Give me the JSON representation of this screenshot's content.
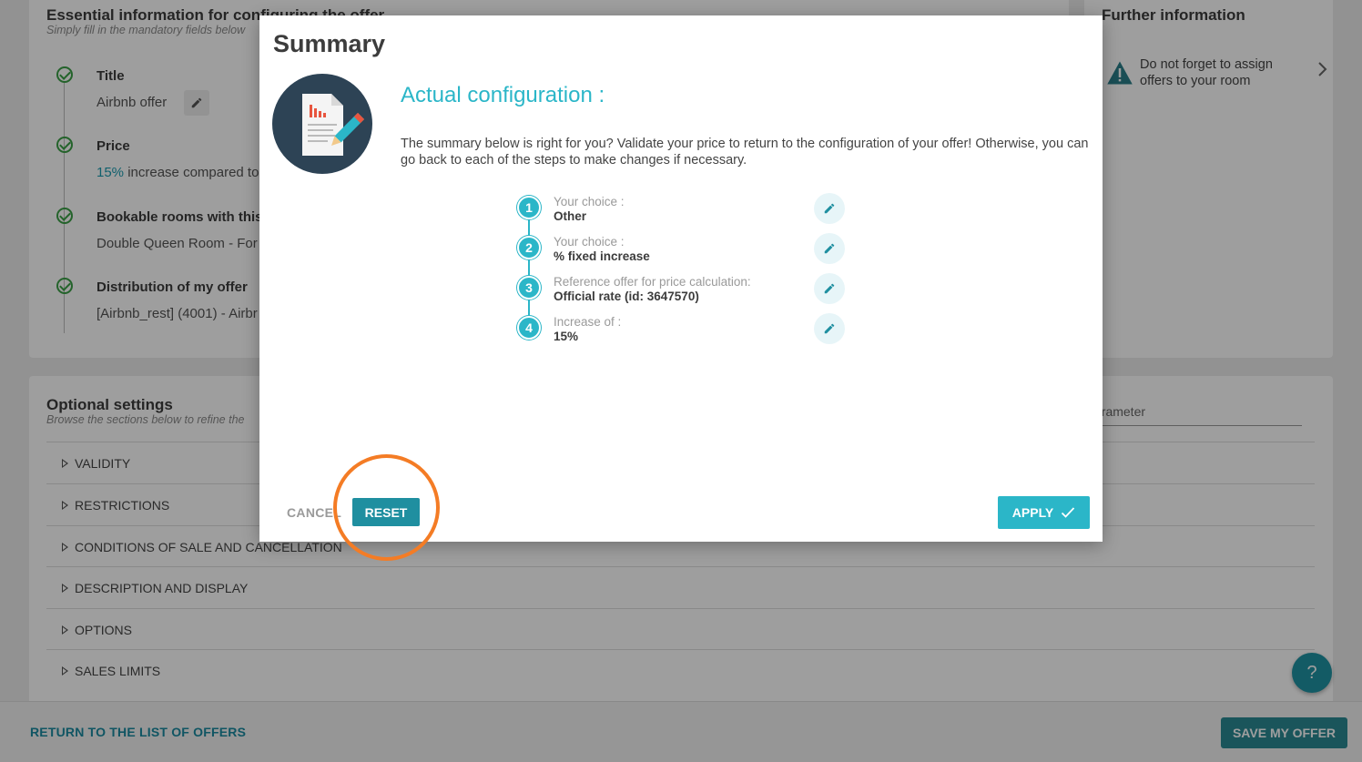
{
  "essential": {
    "title": "Essential information for configuring the offer",
    "subtitle": "Simply fill in the mandatory fields below",
    "steps": [
      {
        "label": "Title",
        "value": "Airbnb offer"
      },
      {
        "label": "Price",
        "value_highlight": "15%",
        "value": " increase compared to"
      },
      {
        "label": "Bookable rooms with this",
        "value": "Double Queen Room - For"
      },
      {
        "label": "Distribution of my offer",
        "value": "[Airbnb_rest] (4001) - Airbr"
      }
    ]
  },
  "further": {
    "title": "Further information",
    "warning": "Do not forget to assign offers to your room"
  },
  "optional": {
    "title": "Optional settings",
    "subtitle": "Browse the sections below to refine the",
    "search_fragment": "arameter",
    "sections": [
      "VALIDITY",
      "RESTRICTIONS",
      "CONDITIONS OF SALE AND CANCELLATION",
      "DESCRIPTION AND DISPLAY",
      "OPTIONS",
      "SALES LIMITS"
    ]
  },
  "footer": {
    "return_label": "RETURN TO THE LIST OF OFFERS",
    "save_label": "SAVE MY OFFER"
  },
  "help_label": "?",
  "modal": {
    "title": "Summary",
    "config_title": "Actual configuration :",
    "description": "The summary below is right for you? Validate your price to return to the configuration of your offer! Otherwise, you can go back to each of the steps to make changes if necessary.",
    "steps": [
      {
        "num": "1",
        "caption": "Your choice :",
        "value": "Other"
      },
      {
        "num": "2",
        "caption": "Your choice :",
        "value": "% fixed increase"
      },
      {
        "num": "3",
        "caption": "Reference offer for price calculation:",
        "value": "Official rate (id: 3647570)"
      },
      {
        "num": "4",
        "caption": "Increase of :",
        "value": "15%"
      }
    ],
    "cancel_label": "CANCEL",
    "reset_label": "RESET",
    "apply_label": "APPLY"
  },
  "colors": {
    "accent": "#2bb6c8",
    "dark_teal": "#1f8fa0",
    "highlight_ring": "#f47c25"
  }
}
